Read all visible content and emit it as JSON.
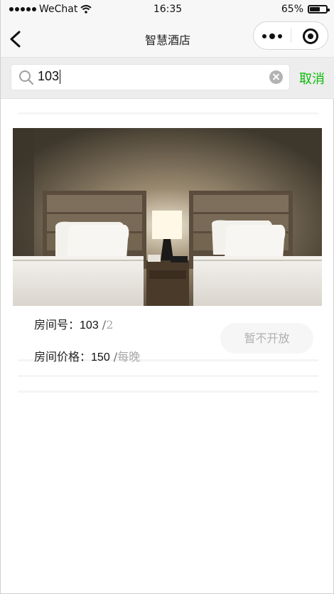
{
  "status_bar": {
    "carrier": "WeChat",
    "time": "16:35",
    "battery_percent_text": "65%",
    "battery_level": 0.65
  },
  "nav": {
    "title": "智慧酒店"
  },
  "search": {
    "value": "103",
    "cancel_label": "取消"
  },
  "room": {
    "room_number_label": "房间号：",
    "room_number": "103",
    "room_sep": " /",
    "room_suffix": "2",
    "price_label": "房间价格：",
    "price": "150",
    "price_sep": " /",
    "price_unit": "每晚",
    "status_button": "暂不开放"
  },
  "colors": {
    "accent": "#09bb07",
    "muted": "#a8a8a8",
    "nav_bg": "#f7f7f7",
    "search_bg": "#ededed"
  }
}
